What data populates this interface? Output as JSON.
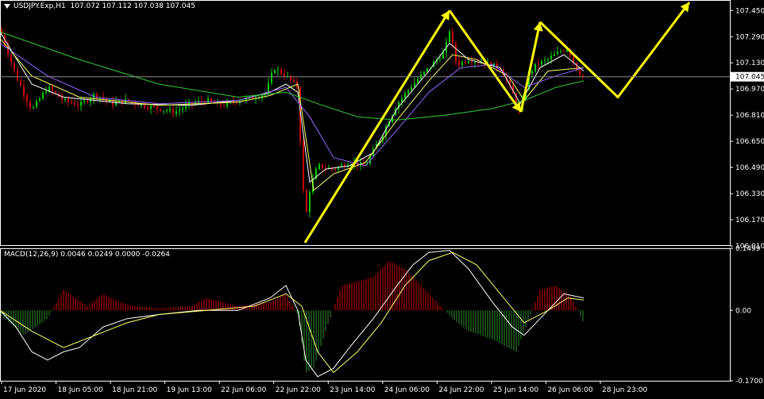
{
  "header": {
    "symbol_label": "USDJPY.Exp,H1",
    "ohlc_label": "107.072 107.112 107.038 107.045"
  },
  "macd_header": {
    "label": "MACD(12,26,9) 0.0046 0.0249 0.0000 -0.0264"
  },
  "colors": {
    "background": "#000000",
    "grid": "#ffffff",
    "bull_candle": "#00cc00",
    "bear_candle": "#cc0000",
    "ma_fast": "#ffffff",
    "ma_yellow": "#ffff66",
    "ma_purple": "#9966ff",
    "ma_green": "#33cc33",
    "arrow": "#ffff00",
    "macd_pos": "#cc0000",
    "macd_neg": "#2f8f2f",
    "macd_line": "#ffffff",
    "signal_line": "#ffff66"
  },
  "chart_data": [
    {
      "type": "candlestick",
      "title": "USDJPY.Exp,H1",
      "ylim": [
        106.01,
        107.5
      ],
      "yticks": [
        "107.450",
        "107.290",
        "107.130",
        "107.045",
        "106.970",
        "106.810",
        "106.650",
        "106.490",
        "106.330",
        "106.170",
        "106.010"
      ],
      "current_price": "107.045",
      "x_ticks": [
        "17 Jun 2020",
        "18 Jun 05:00",
        "18 Jun 21:00",
        "19 Jun 13:00",
        "22 Jun 06:00",
        "22 Jun 22:00",
        "23 Jun 14:00",
        "24 Jun 06:00",
        "24 Jun 22:00",
        "25 Jun 14:00",
        "26 Jun 06:00",
        "28 Jun 23:00"
      ],
      "price_path": [
        [
          0,
          107.33
        ],
        [
          8,
          107.22
        ],
        [
          20,
          107.05
        ],
        [
          40,
          106.84
        ],
        [
          60,
          106.98
        ],
        [
          80,
          106.9
        ],
        [
          100,
          106.87
        ],
        [
          120,
          106.94
        ],
        [
          140,
          106.88
        ],
        [
          160,
          106.9
        ],
        [
          180,
          106.87
        ],
        [
          200,
          106.85
        ],
        [
          220,
          106.83
        ],
        [
          240,
          106.88
        ],
        [
          260,
          106.9
        ],
        [
          280,
          106.87
        ],
        [
          300,
          106.9
        ],
        [
          320,
          106.92
        ],
        [
          335,
          106.95
        ],
        [
          345,
          107.1
        ],
        [
          360,
          107.05
        ],
        [
          375,
          106.98
        ],
        [
          380,
          106.45
        ],
        [
          385,
          106.18
        ],
        [
          390,
          106.35
        ],
        [
          400,
          106.5
        ],
        [
          420,
          106.48
        ],
        [
          440,
          106.52
        ],
        [
          460,
          106.5
        ],
        [
          480,
          106.68
        ],
        [
          500,
          106.88
        ],
        [
          520,
          107.0
        ],
        [
          540,
          107.1
        ],
        [
          560,
          107.2
        ],
        [
          566,
          107.33
        ],
        [
          575,
          107.12
        ],
        [
          590,
          107.15
        ],
        [
          610,
          107.13
        ],
        [
          630,
          107.1
        ],
        [
          645,
          106.95
        ],
        [
          655,
          106.82
        ],
        [
          665,
          107.05
        ],
        [
          675,
          107.12
        ],
        [
          690,
          107.15
        ],
        [
          705,
          107.2
        ],
        [
          715,
          107.22
        ],
        [
          725,
          107.1
        ],
        [
          733,
          107.05
        ]
      ],
      "ma_series": [
        {
          "color": "white",
          "points": [
            [
              0,
              107.32
            ],
            [
              40,
              107.0
            ],
            [
              80,
              106.92
            ],
            [
              160,
              106.88
            ],
            [
              240,
              106.87
            ],
            [
              300,
              106.9
            ],
            [
              340,
              106.95
            ],
            [
              360,
              107.0
            ],
            [
              375,
              106.95
            ],
            [
              390,
              106.4
            ],
            [
              410,
              106.48
            ],
            [
              440,
              106.5
            ],
            [
              470,
              106.58
            ],
            [
              500,
              106.85
            ],
            [
              540,
              107.08
            ],
            [
              566,
              107.25
            ],
            [
              590,
              107.15
            ],
            [
              630,
              107.1
            ],
            [
              655,
              106.88
            ],
            [
              680,
              107.1
            ],
            [
              710,
              107.18
            ],
            [
              735,
              107.08
            ]
          ]
        },
        {
          "color": "yellow",
          "points": [
            [
              0,
              107.28
            ],
            [
              40,
              107.05
            ],
            [
              100,
              106.92
            ],
            [
              200,
              106.87
            ],
            [
              300,
              106.89
            ],
            [
              340,
              106.93
            ],
            [
              375,
              107.0
            ],
            [
              395,
              106.35
            ],
            [
              420,
              106.45
            ],
            [
              460,
              106.52
            ],
            [
              500,
              106.78
            ],
            [
              540,
              107.02
            ],
            [
              570,
              107.18
            ],
            [
              600,
              107.15
            ],
            [
              640,
              107.05
            ],
            [
              660,
              106.9
            ],
            [
              690,
              107.08
            ],
            [
              735,
              107.1
            ]
          ]
        },
        {
          "color": "purple",
          "points": [
            [
              0,
              107.25
            ],
            [
              60,
              107.05
            ],
            [
              120,
              106.92
            ],
            [
              200,
              106.88
            ],
            [
              300,
              106.9
            ],
            [
              360,
              106.98
            ],
            [
              390,
              106.8
            ],
            [
              420,
              106.55
            ],
            [
              460,
              106.5
            ],
            [
              500,
              106.72
            ],
            [
              540,
              106.95
            ],
            [
              580,
              107.1
            ],
            [
              620,
              107.12
            ],
            [
              660,
              106.98
            ],
            [
              700,
              107.05
            ],
            [
              735,
              107.1
            ]
          ]
        },
        {
          "color": "green",
          "points": [
            [
              0,
              107.32
            ],
            [
              100,
              107.15
            ],
            [
              200,
              107.0
            ],
            [
              300,
              106.92
            ],
            [
              360,
              106.95
            ],
            [
              400,
              106.88
            ],
            [
              450,
              106.8
            ],
            [
              500,
              106.78
            ],
            [
              560,
              106.81
            ],
            [
              620,
              106.85
            ],
            [
              660,
              106.9
            ],
            [
              700,
              106.98
            ],
            [
              735,
              107.02
            ]
          ]
        }
      ],
      "annotation_arrows": [
        {
          "points": [
            [
              384,
              106.03
            ],
            [
              566,
              107.45
            ]
          ]
        },
        {
          "points": [
            [
              566,
              107.45
            ],
            [
              656,
              106.83
            ]
          ]
        },
        {
          "points": [
            [
              656,
              106.83
            ],
            [
              680,
              107.38
            ]
          ]
        },
        {
          "points": [
            [
              680,
              107.38
            ],
            [
              778,
              106.92
            ],
            [
              868,
              107.5
            ]
          ]
        }
      ]
    },
    {
      "type": "bar",
      "title": "MACD(12,26,9) 0.0046 0.0249 0.0000 -0.0264",
      "ylim": [
        -0.17,
        0.1499
      ],
      "yticks": [
        "0.1499",
        "0.00",
        "-0.1700"
      ],
      "histogram_path": [
        [
          0,
          -0.01
        ],
        [
          30,
          -0.06
        ],
        [
          60,
          -0.02
        ],
        [
          80,
          0.05
        ],
        [
          95,
          0.03
        ],
        [
          110,
          0.01
        ],
        [
          130,
          0.04
        ],
        [
          150,
          0.02
        ],
        [
          170,
          0.01
        ],
        [
          200,
          0.005
        ],
        [
          240,
          0.01
        ],
        [
          260,
          0.03
        ],
        [
          300,
          0.01
        ],
        [
          340,
          0.02
        ],
        [
          360,
          0.04
        ],
        [
          375,
          -0.01
        ],
        [
          385,
          -0.15
        ],
        [
          395,
          -0.14
        ],
        [
          410,
          -0.05
        ],
        [
          430,
          0.06
        ],
        [
          450,
          0.07
        ],
        [
          470,
          0.08
        ],
        [
          490,
          0.12
        ],
        [
          510,
          0.1
        ],
        [
          530,
          0.06
        ],
        [
          550,
          0.02
        ],
        [
          570,
          -0.02
        ],
        [
          590,
          -0.05
        ],
        [
          620,
          -0.07
        ],
        [
          650,
          -0.1
        ],
        [
          660,
          -0.05
        ],
        [
          680,
          0.05
        ],
        [
          700,
          0.06
        ],
        [
          720,
          0.03
        ],
        [
          735,
          -0.03
        ]
      ],
      "macd_line": [
        [
          0,
          0.0
        ],
        [
          20,
          -0.04
        ],
        [
          40,
          -0.1
        ],
        [
          60,
          -0.12
        ],
        [
          80,
          -0.1
        ],
        [
          100,
          -0.09
        ],
        [
          130,
          -0.04
        ],
        [
          160,
          -0.02
        ],
        [
          200,
          -0.01
        ],
        [
          250,
          0.0
        ],
        [
          300,
          0.0
        ],
        [
          340,
          0.03
        ],
        [
          360,
          0.06
        ],
        [
          375,
          0.0
        ],
        [
          385,
          -0.12
        ],
        [
          400,
          -0.16
        ],
        [
          420,
          -0.14
        ],
        [
          440,
          -0.09
        ],
        [
          470,
          -0.02
        ],
        [
          500,
          0.06
        ],
        [
          520,
          0.11
        ],
        [
          540,
          0.14
        ],
        [
          566,
          0.145
        ],
        [
          590,
          0.1
        ],
        [
          620,
          0.02
        ],
        [
          645,
          -0.04
        ],
        [
          660,
          -0.06
        ],
        [
          680,
          -0.02
        ],
        [
          710,
          0.04
        ],
        [
          735,
          0.03
        ]
      ],
      "signal_line": [
        [
          0,
          0.0
        ],
        [
          40,
          -0.05
        ],
        [
          80,
          -0.09
        ],
        [
          120,
          -0.06
        ],
        [
          160,
          -0.03
        ],
        [
          200,
          -0.01
        ],
        [
          260,
          0.0
        ],
        [
          320,
          0.01
        ],
        [
          360,
          0.04
        ],
        [
          380,
          0.01
        ],
        [
          400,
          -0.1
        ],
        [
          420,
          -0.15
        ],
        [
          450,
          -0.1
        ],
        [
          480,
          -0.03
        ],
        [
          510,
          0.06
        ],
        [
          540,
          0.12
        ],
        [
          570,
          0.14
        ],
        [
          600,
          0.11
        ],
        [
          630,
          0.04
        ],
        [
          660,
          -0.03
        ],
        [
          690,
          0.0
        ],
        [
          715,
          0.03
        ],
        [
          735,
          0.025
        ]
      ]
    }
  ]
}
